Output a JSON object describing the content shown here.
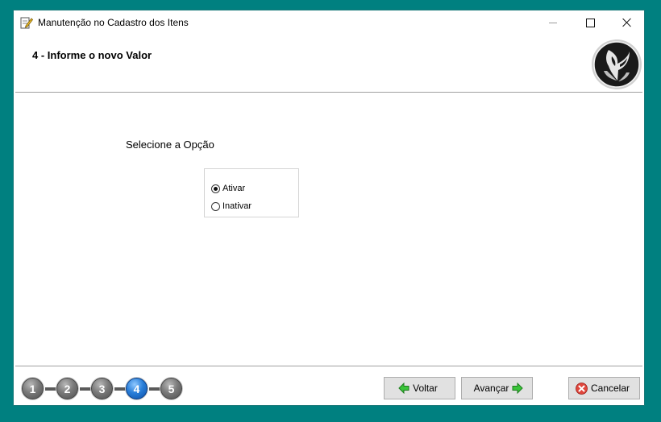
{
  "window": {
    "title": "Manutenção no Cadastro dos Itens"
  },
  "header": {
    "step_title": "4 - Informe o novo Valor"
  },
  "main": {
    "prompt": "Selecione a Opção",
    "options": [
      {
        "label": "Ativar",
        "selected": true
      },
      {
        "label": "Inativar",
        "selected": false
      }
    ]
  },
  "wizard": {
    "steps": [
      "1",
      "2",
      "3",
      "4",
      "5"
    ],
    "current_step": 4
  },
  "buttons": {
    "back": "Voltar",
    "next": "Avançar",
    "cancel": "Cancelar"
  },
  "colors": {
    "desktop": "#008080",
    "active_step": "#1f6fcf",
    "arrow_green": "#2db62d",
    "cancel_red": "#d9342b"
  }
}
